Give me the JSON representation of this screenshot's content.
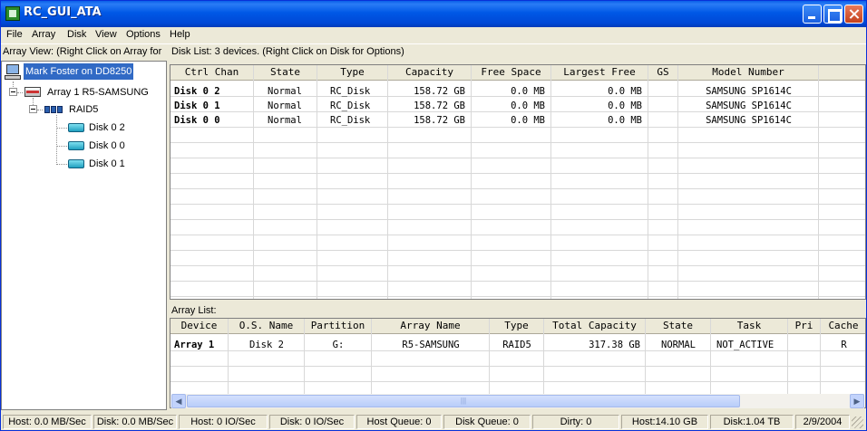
{
  "window": {
    "title": "RC_GUI_ATA"
  },
  "menu": [
    "File",
    "Array",
    "Disk",
    "View",
    "Options",
    "Help"
  ],
  "array_view": {
    "header": "Array View:  (Right Click on Array for",
    "host": "Mark Foster on DD8250",
    "array": "Array 1  R5-SAMSUNG",
    "raid": "RAID5",
    "disks": [
      "Disk  0 2",
      "Disk  0 0",
      "Disk  0 1"
    ]
  },
  "disk_list": {
    "header": "Disk List: 3 devices.  (Right Click on Disk for Options)",
    "columns": [
      "Ctrl Chan",
      "State",
      "Type",
      "Capacity",
      "Free Space",
      "Largest Free",
      "GS",
      "Model Number"
    ],
    "rows": [
      {
        "ctrl_chan": "Disk  0 2",
        "state": "Normal",
        "type": "RC_Disk",
        "capacity": "158.72 GB",
        "free": "0.0 MB",
        "largest": "0.0 MB",
        "gs": "",
        "model": "SAMSUNG SP1614C"
      },
      {
        "ctrl_chan": "Disk  0 1",
        "state": "Normal",
        "type": "RC_Disk",
        "capacity": "158.72 GB",
        "free": "0.0 MB",
        "largest": "0.0 MB",
        "gs": "",
        "model": "SAMSUNG SP1614C"
      },
      {
        "ctrl_chan": "Disk  0 0",
        "state": "Normal",
        "type": "RC_Disk",
        "capacity": "158.72 GB",
        "free": "0.0 MB",
        "largest": "0.0 MB",
        "gs": "",
        "model": "SAMSUNG SP1614C"
      }
    ]
  },
  "array_list": {
    "header": "Array List:",
    "columns": [
      "Device",
      "O.S. Name",
      "Partition",
      "Array Name",
      "Type",
      "Total Capacity",
      "State",
      "Task",
      "Pri",
      "Cache"
    ],
    "rows": [
      {
        "device": "Array 1",
        "os_name": "Disk 2",
        "partition": "G:",
        "array_name": "R5-SAMSUNG",
        "type": "RAID5",
        "total": "317.38 GB",
        "state": "NORMAL",
        "task": "NOT_ACTIVE",
        "pri": "",
        "cache": "R"
      }
    ]
  },
  "status": [
    "Host: 0.0 MB/Sec",
    "Disk: 0.0 MB/Sec",
    "Host: 0 IO/Sec",
    "Disk: 0 IO/Sec",
    "Host Queue: 0",
    "Disk Queue: 0",
    "Dirty: 0",
    "Host:14.10 GB",
    "Disk:1.04 TB",
    "2/9/2004"
  ]
}
